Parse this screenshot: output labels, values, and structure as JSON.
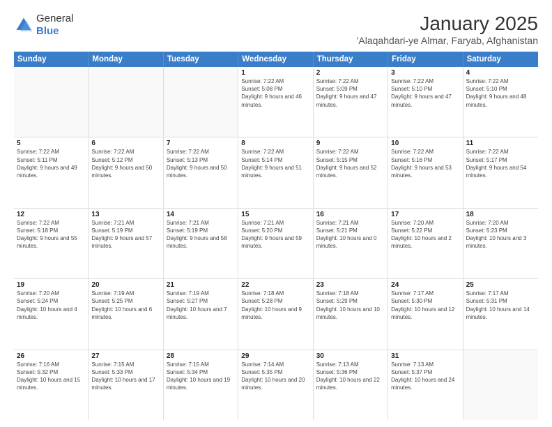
{
  "logo": {
    "general": "General",
    "blue": "Blue"
  },
  "header": {
    "month": "January 2025",
    "location": "'Alaqahdari-ye Almar, Faryab, Afghanistan"
  },
  "days_of_week": [
    "Sunday",
    "Monday",
    "Tuesday",
    "Wednesday",
    "Thursday",
    "Friday",
    "Saturday"
  ],
  "weeks": [
    [
      {
        "day": "",
        "sunrise": "",
        "sunset": "",
        "daylight": ""
      },
      {
        "day": "",
        "sunrise": "",
        "sunset": "",
        "daylight": ""
      },
      {
        "day": "",
        "sunrise": "",
        "sunset": "",
        "daylight": ""
      },
      {
        "day": "1",
        "sunrise": "Sunrise: 7:22 AM",
        "sunset": "Sunset: 5:08 PM",
        "daylight": "Daylight: 9 hours and 46 minutes."
      },
      {
        "day": "2",
        "sunrise": "Sunrise: 7:22 AM",
        "sunset": "Sunset: 5:09 PM",
        "daylight": "Daylight: 9 hours and 47 minutes."
      },
      {
        "day": "3",
        "sunrise": "Sunrise: 7:22 AM",
        "sunset": "Sunset: 5:10 PM",
        "daylight": "Daylight: 9 hours and 47 minutes."
      },
      {
        "day": "4",
        "sunrise": "Sunrise: 7:22 AM",
        "sunset": "Sunset: 5:10 PM",
        "daylight": "Daylight: 9 hours and 48 minutes."
      }
    ],
    [
      {
        "day": "5",
        "sunrise": "Sunrise: 7:22 AM",
        "sunset": "Sunset: 5:11 PM",
        "daylight": "Daylight: 9 hours and 49 minutes."
      },
      {
        "day": "6",
        "sunrise": "Sunrise: 7:22 AM",
        "sunset": "Sunset: 5:12 PM",
        "daylight": "Daylight: 9 hours and 50 minutes."
      },
      {
        "day": "7",
        "sunrise": "Sunrise: 7:22 AM",
        "sunset": "Sunset: 5:13 PM",
        "daylight": "Daylight: 9 hours and 50 minutes."
      },
      {
        "day": "8",
        "sunrise": "Sunrise: 7:22 AM",
        "sunset": "Sunset: 5:14 PM",
        "daylight": "Daylight: 9 hours and 51 minutes."
      },
      {
        "day": "9",
        "sunrise": "Sunrise: 7:22 AM",
        "sunset": "Sunset: 5:15 PM",
        "daylight": "Daylight: 9 hours and 52 minutes."
      },
      {
        "day": "10",
        "sunrise": "Sunrise: 7:22 AM",
        "sunset": "Sunset: 5:16 PM",
        "daylight": "Daylight: 9 hours and 53 minutes."
      },
      {
        "day": "11",
        "sunrise": "Sunrise: 7:22 AM",
        "sunset": "Sunset: 5:17 PM",
        "daylight": "Daylight: 9 hours and 54 minutes."
      }
    ],
    [
      {
        "day": "12",
        "sunrise": "Sunrise: 7:22 AM",
        "sunset": "Sunset: 5:18 PM",
        "daylight": "Daylight: 9 hours and 55 minutes."
      },
      {
        "day": "13",
        "sunrise": "Sunrise: 7:21 AM",
        "sunset": "Sunset: 5:19 PM",
        "daylight": "Daylight: 9 hours and 57 minutes."
      },
      {
        "day": "14",
        "sunrise": "Sunrise: 7:21 AM",
        "sunset": "Sunset: 5:19 PM",
        "daylight": "Daylight: 9 hours and 58 minutes."
      },
      {
        "day": "15",
        "sunrise": "Sunrise: 7:21 AM",
        "sunset": "Sunset: 5:20 PM",
        "daylight": "Daylight: 9 hours and 59 minutes."
      },
      {
        "day": "16",
        "sunrise": "Sunrise: 7:21 AM",
        "sunset": "Sunset: 5:21 PM",
        "daylight": "Daylight: 10 hours and 0 minutes."
      },
      {
        "day": "17",
        "sunrise": "Sunrise: 7:20 AM",
        "sunset": "Sunset: 5:22 PM",
        "daylight": "Daylight: 10 hours and 2 minutes."
      },
      {
        "day": "18",
        "sunrise": "Sunrise: 7:20 AM",
        "sunset": "Sunset: 5:23 PM",
        "daylight": "Daylight: 10 hours and 3 minutes."
      }
    ],
    [
      {
        "day": "19",
        "sunrise": "Sunrise: 7:20 AM",
        "sunset": "Sunset: 5:24 PM",
        "daylight": "Daylight: 10 hours and 4 minutes."
      },
      {
        "day": "20",
        "sunrise": "Sunrise: 7:19 AM",
        "sunset": "Sunset: 5:25 PM",
        "daylight": "Daylight: 10 hours and 6 minutes."
      },
      {
        "day": "21",
        "sunrise": "Sunrise: 7:19 AM",
        "sunset": "Sunset: 5:27 PM",
        "daylight": "Daylight: 10 hours and 7 minutes."
      },
      {
        "day": "22",
        "sunrise": "Sunrise: 7:18 AM",
        "sunset": "Sunset: 5:28 PM",
        "daylight": "Daylight: 10 hours and 9 minutes."
      },
      {
        "day": "23",
        "sunrise": "Sunrise: 7:18 AM",
        "sunset": "Sunset: 5:29 PM",
        "daylight": "Daylight: 10 hours and 10 minutes."
      },
      {
        "day": "24",
        "sunrise": "Sunrise: 7:17 AM",
        "sunset": "Sunset: 5:30 PM",
        "daylight": "Daylight: 10 hours and 12 minutes."
      },
      {
        "day": "25",
        "sunrise": "Sunrise: 7:17 AM",
        "sunset": "Sunset: 5:31 PM",
        "daylight": "Daylight: 10 hours and 14 minutes."
      }
    ],
    [
      {
        "day": "26",
        "sunrise": "Sunrise: 7:16 AM",
        "sunset": "Sunset: 5:32 PM",
        "daylight": "Daylight: 10 hours and 15 minutes."
      },
      {
        "day": "27",
        "sunrise": "Sunrise: 7:15 AM",
        "sunset": "Sunset: 5:33 PM",
        "daylight": "Daylight: 10 hours and 17 minutes."
      },
      {
        "day": "28",
        "sunrise": "Sunrise: 7:15 AM",
        "sunset": "Sunset: 5:34 PM",
        "daylight": "Daylight: 10 hours and 19 minutes."
      },
      {
        "day": "29",
        "sunrise": "Sunrise: 7:14 AM",
        "sunset": "Sunset: 5:35 PM",
        "daylight": "Daylight: 10 hours and 20 minutes."
      },
      {
        "day": "30",
        "sunrise": "Sunrise: 7:13 AM",
        "sunset": "Sunset: 5:36 PM",
        "daylight": "Daylight: 10 hours and 22 minutes."
      },
      {
        "day": "31",
        "sunrise": "Sunrise: 7:13 AM",
        "sunset": "Sunset: 5:37 PM",
        "daylight": "Daylight: 10 hours and 24 minutes."
      },
      {
        "day": "",
        "sunrise": "",
        "sunset": "",
        "daylight": ""
      }
    ]
  ]
}
